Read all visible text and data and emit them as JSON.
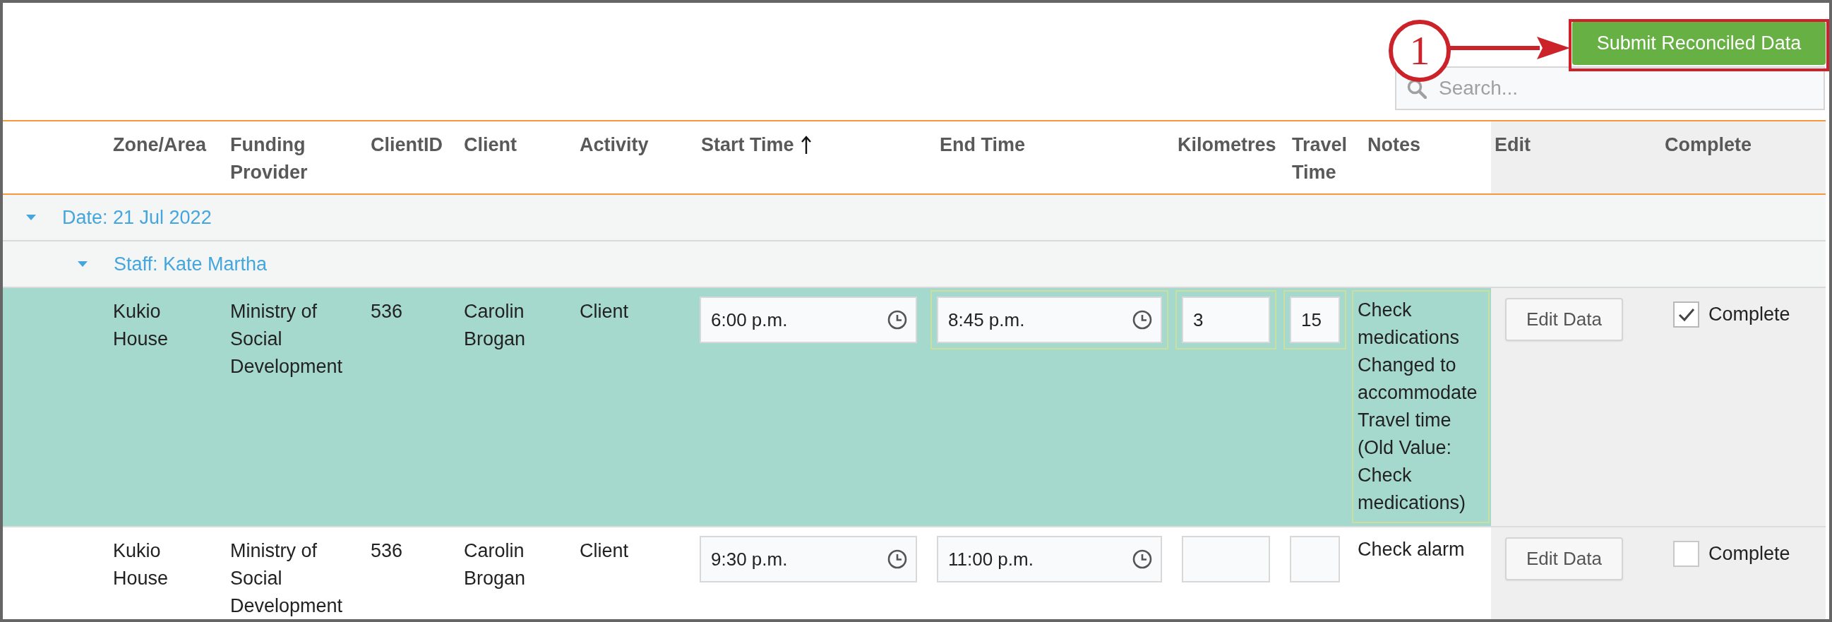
{
  "toolbar": {
    "submit_button": "Submit Reconciled Data",
    "search": {
      "placeholder": "Search..."
    }
  },
  "callout": {
    "number": "1"
  },
  "table": {
    "columns": [
      {
        "label": "Zone/Area",
        "sorted": false
      },
      {
        "label": "Funding Provider",
        "sorted": false
      },
      {
        "label": "ClientID",
        "sorted": false
      },
      {
        "label": "Client",
        "sorted": false
      },
      {
        "label": "Activity",
        "sorted": false
      },
      {
        "label": "Start Time",
        "sorted": true
      },
      {
        "label": "End Time",
        "sorted": false
      },
      {
        "label": "Kilometres",
        "sorted": false
      },
      {
        "label": "Travel Time",
        "sorted": false
      },
      {
        "label": "Notes",
        "sorted": false
      },
      {
        "label": "Edit",
        "sorted": false
      },
      {
        "label": "Complete",
        "sorted": false
      }
    ],
    "groups": [
      {
        "label": "Date: 21 Jul 2022",
        "expanded": true,
        "children": [
          {
            "label": "Staff: Kate Martha",
            "expanded": true,
            "rows": [
              {
                "selected": true,
                "zone": "Kukio House",
                "funding_provider": "Ministry of Social Development",
                "client_id": "536",
                "client": "Carolin Brogan",
                "activity": "Client",
                "start_time": {
                  "value": "6:00 p.m.",
                  "changed": false
                },
                "end_time": {
                  "value": "8:45 p.m.",
                  "changed": true
                },
                "kilometres": {
                  "value": "3",
                  "changed": true
                },
                "travel_time": {
                  "value": "15",
                  "changed": true
                },
                "notes": {
                  "value": "Check medications Changed to accommodate Travel time (Old Value: Check medications)",
                  "changed": true
                },
                "edit_button": "Edit Data",
                "complete": {
                  "label": "Complete",
                  "checked": true
                }
              },
              {
                "selected": false,
                "zone": "Kukio House",
                "funding_provider": "Ministry of Social Development",
                "client_id": "536",
                "client": "Carolin Brogan",
                "activity": "Client",
                "start_time": {
                  "value": "9:30 p.m.",
                  "changed": false
                },
                "end_time": {
                  "value": "11:00 p.m.",
                  "changed": false
                },
                "kilometres": {
                  "changed": false
                },
                "travel_time": {
                  "changed": false
                },
                "notes": {
                  "value": "Check alarm",
                  "changed": false
                },
                "edit_button": "Edit Data",
                "complete": {
                  "label": "Complete",
                  "checked": false
                }
              }
            ]
          }
        ]
      }
    ]
  }
}
